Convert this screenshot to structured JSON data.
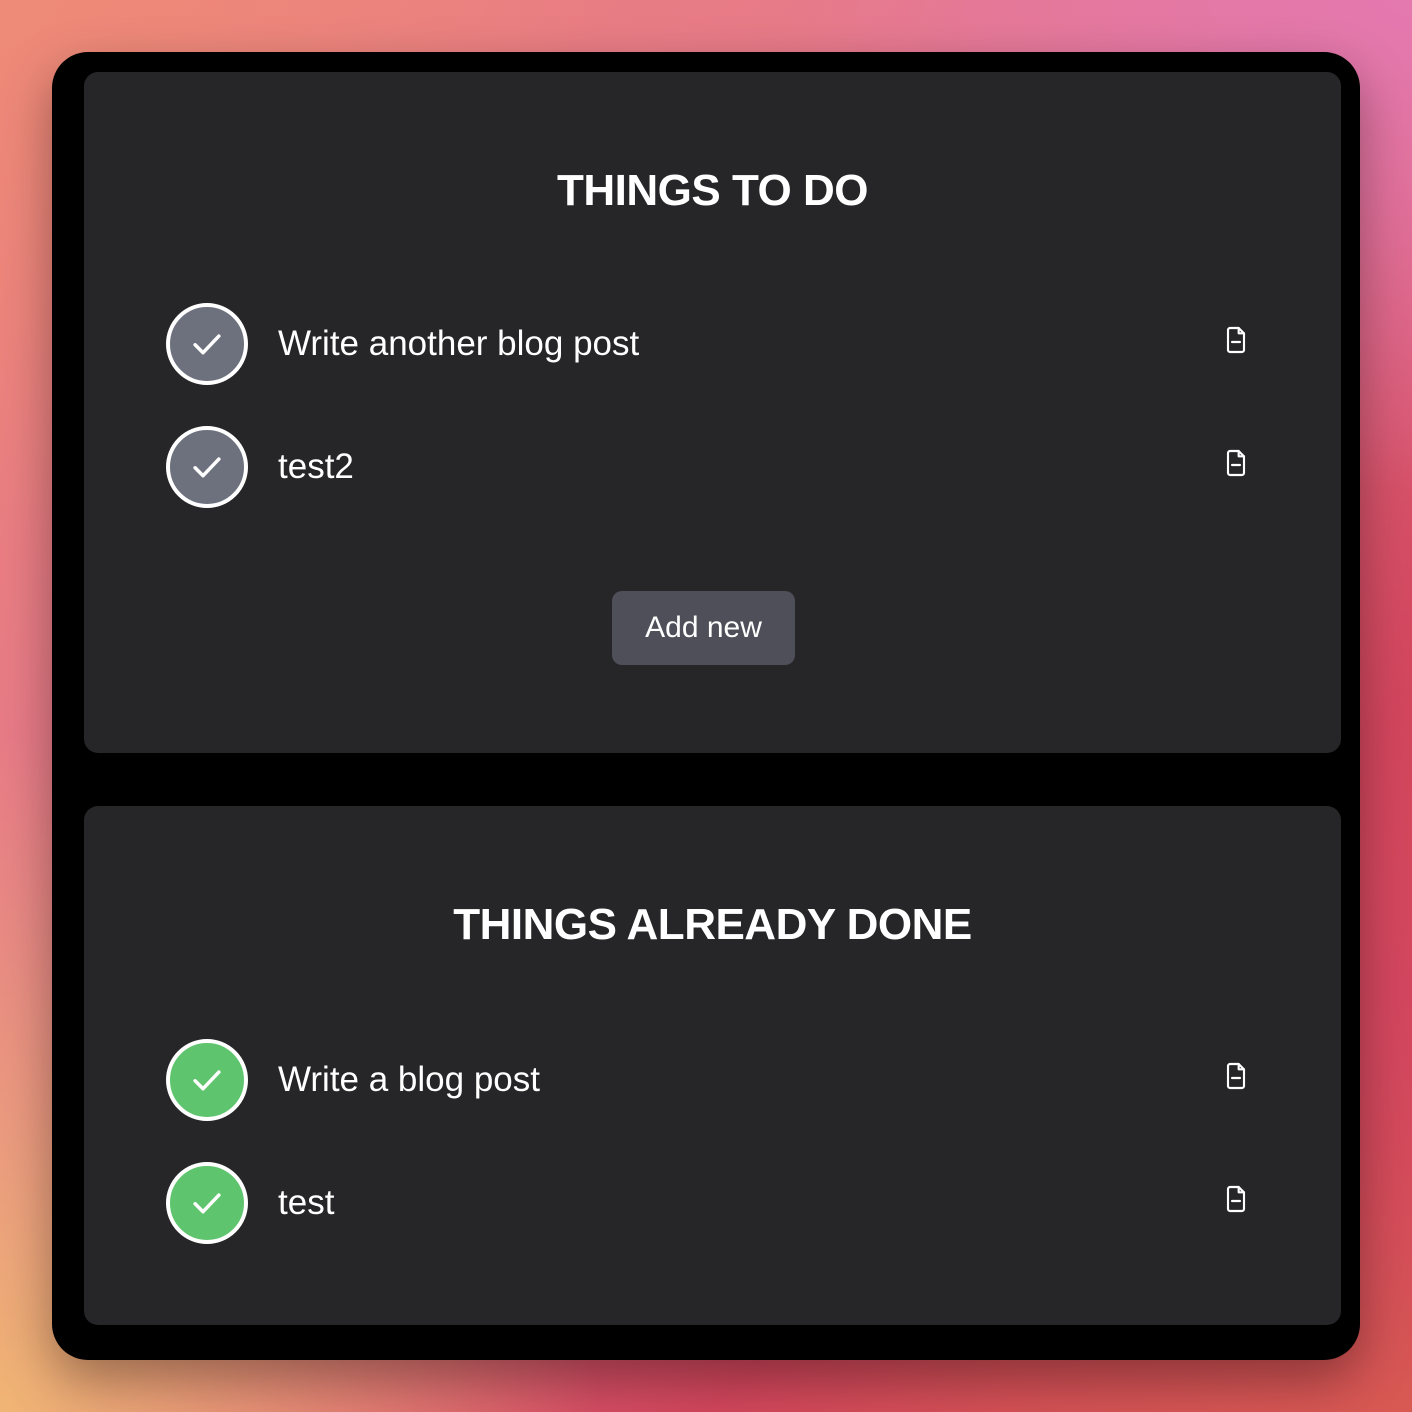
{
  "colors": {
    "window_bg": "#000000",
    "card_bg": "#262628",
    "pending_check": "#6c717d",
    "done_check": "#5fc46e",
    "button_bg": "#4e4f58",
    "text": "#ffffff"
  },
  "todo": {
    "title": "THINGS TO DO",
    "items": [
      {
        "label": "Write another blog post",
        "status_icon": "check-icon",
        "action_icon": "document-minus-icon"
      },
      {
        "label": "test2",
        "status_icon": "check-icon",
        "action_icon": "document-minus-icon"
      }
    ],
    "add_button_label": "Add new"
  },
  "done": {
    "title": "THINGS ALREADY DONE",
    "items": [
      {
        "label": "Write a blog post",
        "status_icon": "check-icon",
        "action_icon": "document-minus-icon"
      },
      {
        "label": "test",
        "status_icon": "check-icon",
        "action_icon": "document-minus-icon"
      }
    ]
  }
}
